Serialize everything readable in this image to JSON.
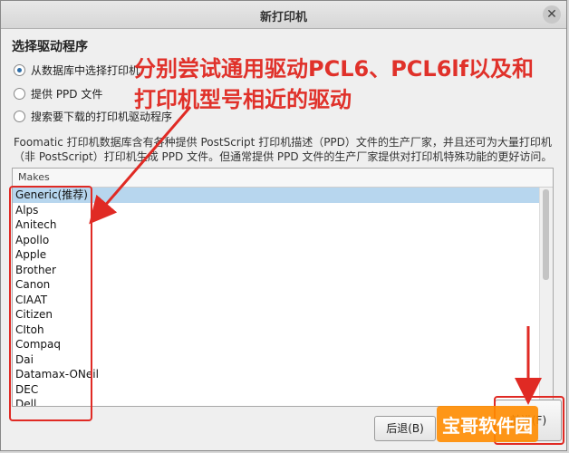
{
  "window": {
    "title": "新打印机",
    "close_glyph": "✕"
  },
  "section": {
    "title": "选择驱动程序",
    "options": [
      {
        "label": "从数据库中选择打印机",
        "checked": true
      },
      {
        "label": "提供 PPD 文件",
        "checked": false
      },
      {
        "label": "搜索要下载的打印机驱动程序",
        "checked": false
      }
    ],
    "description": "Foomatic 打印机数据库含有各种提供 PostScript 打印机描述（PPD）文件的生产厂家，并且还可为大量打印机（非 PostScript）打印机生成 PPD 文件。但通常提供 PPD 文件的生产厂家提供对打印机特殊功能的更好访问。"
  },
  "makes": {
    "header": "Makes",
    "items": [
      "Generic(推荐)",
      "Alps",
      "Anitech",
      "Apollo",
      "Apple",
      "Brother",
      "Canon",
      "CIAAT",
      "Citizen",
      "CItoh",
      "Compaq",
      "Dai",
      "Datamax-ONeil",
      "DEC",
      "Dell"
    ],
    "selected_index": 0
  },
  "annotation": {
    "line1": "分别尝试通用驱动PCL6、PCL6lf以及和",
    "line2": "打印机型号相近的驱动",
    "color": "#e0312a"
  },
  "buttons": {
    "back": "后退(B)",
    "forward": "前进(F)"
  },
  "watermark": {
    "text": "宝哥软件园"
  }
}
